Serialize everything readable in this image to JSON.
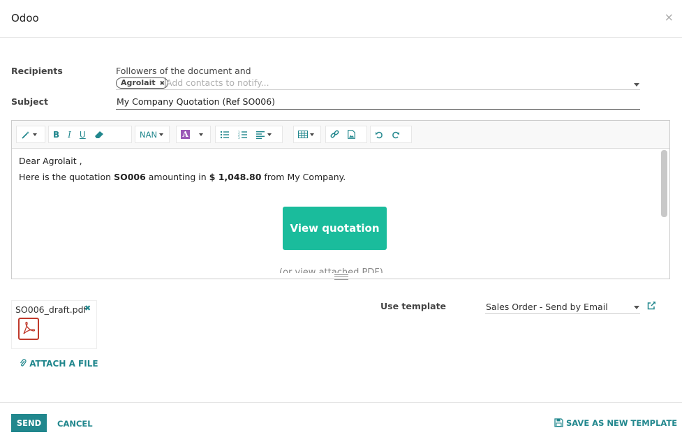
{
  "dialog": {
    "title": "Odoo",
    "close_symbol": "×"
  },
  "recipients": {
    "label": "Recipients",
    "followers_text": "Followers of the document and",
    "tags": [
      {
        "label": "Agrolait",
        "remove_symbol": "✖"
      }
    ],
    "placeholder": "Add contacts to notify..."
  },
  "subject": {
    "label": "Subject",
    "value": "My Company Quotation (Ref SO006)"
  },
  "toolbar": {
    "font_size_label": "NAN",
    "bold": "B",
    "italic": "I",
    "underline": "U"
  },
  "body": {
    "greeting": "Dear Agrolait ,",
    "line_prefix": "Here is the quotation ",
    "quotation_ref": "SO006",
    "line_mid": " amounting in ",
    "amount": "$ 1,048.80",
    "line_suffix": " from My Company.",
    "view_button": "View quotation",
    "pdf_note": "(or view attached PDF)"
  },
  "attachment": {
    "filename": "SO006_draft.pdf",
    "remove_symbol": "✖",
    "attach_label": "ATTACH A FILE"
  },
  "template": {
    "label": "Use template",
    "value": "Sales Order - Send by Email"
  },
  "footer": {
    "send": "SEND",
    "cancel": "CANCEL",
    "save_template": "SAVE AS NEW TEMPLATE"
  },
  "colors": {
    "accent": "#21878d",
    "button_green": "#1abc9c",
    "pdf_red": "#c0392b"
  }
}
